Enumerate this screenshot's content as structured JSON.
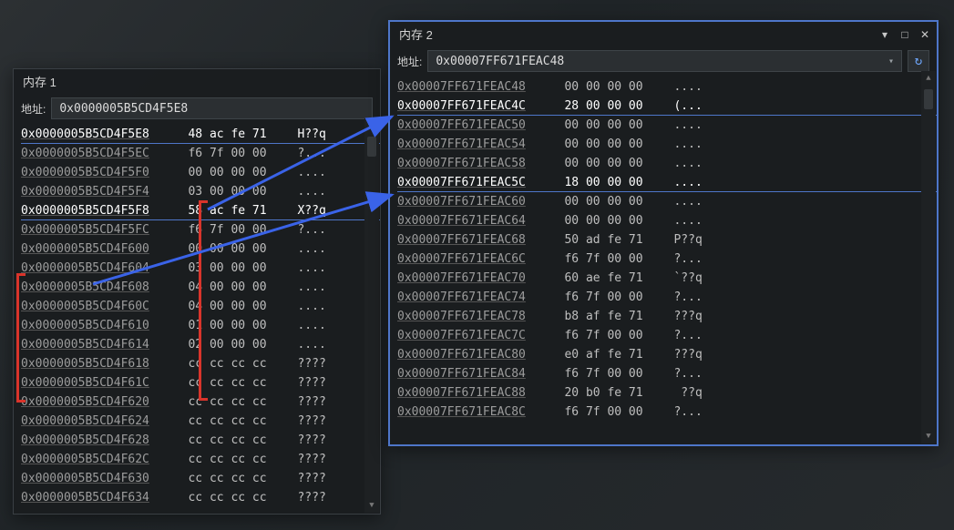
{
  "mem1": {
    "title": "内存 1",
    "addr_label": "地址:",
    "addr_value": "0x0000005B5CD4F5E8",
    "rows": [
      {
        "a": "0x0000005B5CD4F5E8",
        "h": "48 ac fe 71",
        "s": "H??q",
        "hl": true
      },
      {
        "a": "0x0000005B5CD4F5EC",
        "h": "f6 7f 00 00",
        "s": "?..."
      },
      {
        "a": "0x0000005B5CD4F5F0",
        "h": "00 00 00 00",
        "s": "...."
      },
      {
        "a": "0x0000005B5CD4F5F4",
        "h": "03 00 00 00",
        "s": "...."
      },
      {
        "a": "0x0000005B5CD4F5F8",
        "h": "58 ac fe 71",
        "s": "X??q",
        "hl": true
      },
      {
        "a": "0x0000005B5CD4F5FC",
        "h": "f6 7f 00 00",
        "s": "?..."
      },
      {
        "a": "0x0000005B5CD4F600",
        "h": "00 00 00 00",
        "s": "...."
      },
      {
        "a": "0x0000005B5CD4F604",
        "h": "03 00 00 00",
        "s": "...."
      },
      {
        "a": "0x0000005B5CD4F608",
        "h": "04 00 00 00",
        "s": "...."
      },
      {
        "a": "0x0000005B5CD4F60C",
        "h": "04 00 00 00",
        "s": "...."
      },
      {
        "a": "0x0000005B5CD4F610",
        "h": "01 00 00 00",
        "s": "...."
      },
      {
        "a": "0x0000005B5CD4F614",
        "h": "02 00 00 00",
        "s": "...."
      },
      {
        "a": "0x0000005B5CD4F618",
        "h": "cc cc cc cc",
        "s": "????"
      },
      {
        "a": "0x0000005B5CD4F61C",
        "h": "cc cc cc cc",
        "s": "????"
      },
      {
        "a": "0x0000005B5CD4F620",
        "h": "cc cc cc cc",
        "s": "????"
      },
      {
        "a": "0x0000005B5CD4F624",
        "h": "cc cc cc cc",
        "s": "????"
      },
      {
        "a": "0x0000005B5CD4F628",
        "h": "cc cc cc cc",
        "s": "????"
      },
      {
        "a": "0x0000005B5CD4F62C",
        "h": "cc cc cc cc",
        "s": "????"
      },
      {
        "a": "0x0000005B5CD4F630",
        "h": "cc cc cc cc",
        "s": "????"
      },
      {
        "a": "0x0000005B5CD4F634",
        "h": "cc cc cc cc",
        "s": "????"
      }
    ]
  },
  "mem2": {
    "title": "内存 2",
    "addr_label": "地址:",
    "addr_value": "0x00007FF671FEAC48",
    "rows": [
      {
        "a": "0x00007FF671FEAC48",
        "h": "00 00 00 00",
        "s": "...."
      },
      {
        "a": "0x00007FF671FEAC4C",
        "h": "28 00 00 00",
        "s": "(...",
        "hl": true
      },
      {
        "a": "0x00007FF671FEAC50",
        "h": "00 00 00 00",
        "s": "...."
      },
      {
        "a": "0x00007FF671FEAC54",
        "h": "00 00 00 00",
        "s": "...."
      },
      {
        "a": "0x00007FF671FEAC58",
        "h": "00 00 00 00",
        "s": "...."
      },
      {
        "a": "0x00007FF671FEAC5C",
        "h": "18 00 00 00",
        "s": "....",
        "hl": true
      },
      {
        "a": "0x00007FF671FEAC60",
        "h": "00 00 00 00",
        "s": "...."
      },
      {
        "a": "0x00007FF671FEAC64",
        "h": "00 00 00 00",
        "s": "...."
      },
      {
        "a": "0x00007FF671FEAC68",
        "h": "50 ad fe 71",
        "s": "P??q"
      },
      {
        "a": "0x00007FF671FEAC6C",
        "h": "f6 7f 00 00",
        "s": "?..."
      },
      {
        "a": "0x00007FF671FEAC70",
        "h": "60 ae fe 71",
        "s": "`??q"
      },
      {
        "a": "0x00007FF671FEAC74",
        "h": "f6 7f 00 00",
        "s": "?..."
      },
      {
        "a": "0x00007FF671FEAC78",
        "h": "b8 af fe 71",
        "s": "???q"
      },
      {
        "a": "0x00007FF671FEAC7C",
        "h": "f6 7f 00 00",
        "s": "?..."
      },
      {
        "a": "0x00007FF671FEAC80",
        "h": "e0 af fe 71",
        "s": "???q"
      },
      {
        "a": "0x00007FF671FEAC84",
        "h": "f6 7f 00 00",
        "s": "?..."
      },
      {
        "a": "0x00007FF671FEAC88",
        "h": "20 b0 fe 71",
        "s": " ??q"
      },
      {
        "a": "0x00007FF671FEAC8C",
        "h": "f6 7f 00 00",
        "s": "?..."
      }
    ]
  },
  "icons": {
    "dropdown": "▾",
    "maximize": "□",
    "close": "✕",
    "refresh": "↻",
    "caret": "▾",
    "up": "▲",
    "down": "▼"
  }
}
